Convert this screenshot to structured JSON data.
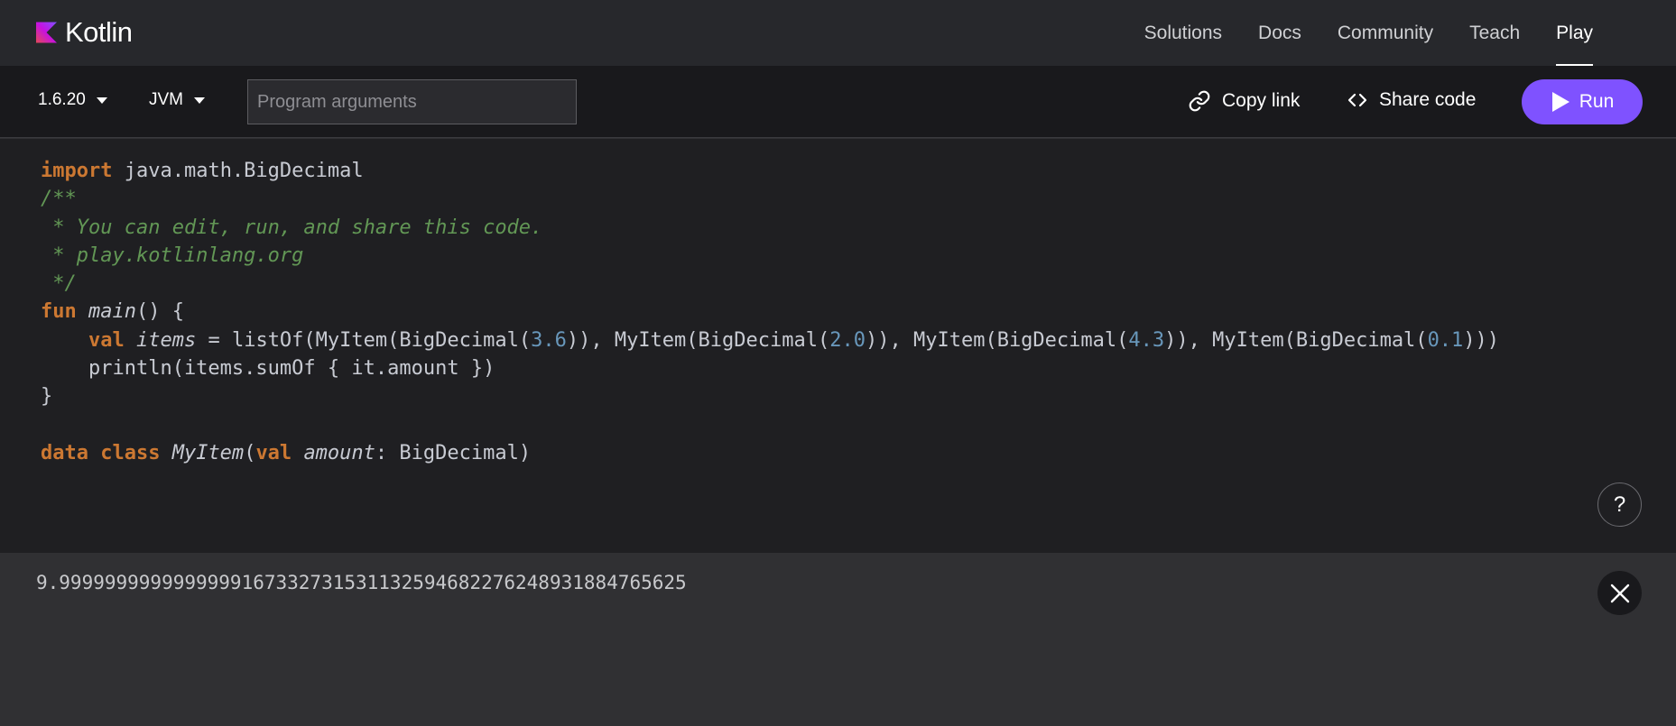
{
  "header": {
    "logo_text": "Kotlin",
    "nav": [
      {
        "label": "Solutions"
      },
      {
        "label": "Docs"
      },
      {
        "label": "Community"
      },
      {
        "label": "Teach"
      },
      {
        "label": "Play",
        "active": true
      }
    ]
  },
  "toolbar": {
    "version": "1.6.20",
    "target": "JVM",
    "args_placeholder": "Program arguments",
    "args_value": "",
    "copy_link_label": "Copy link",
    "share_code_label": "Share code",
    "run_label": "Run"
  },
  "editor": {
    "lines": [
      [
        {
          "t": "import",
          "c": "kw"
        },
        {
          "t": " java.math.BigDecimal"
        }
      ],
      [
        {
          "t": "/**",
          "c": "cm"
        }
      ],
      [
        {
          "t": " * You can edit, run, and share this code.",
          "c": "cm"
        }
      ],
      [
        {
          "t": " * play.kotlinlang.org",
          "c": "cm"
        }
      ],
      [
        {
          "t": " */",
          "c": "cm"
        }
      ],
      [
        {
          "t": "fun",
          "c": "kw"
        },
        {
          "t": " "
        },
        {
          "t": "main",
          "c": "it"
        },
        {
          "t": "() {"
        }
      ],
      [
        {
          "t": "    "
        },
        {
          "t": "val",
          "c": "kw"
        },
        {
          "t": " "
        },
        {
          "t": "items",
          "c": "it"
        },
        {
          "t": " = listOf(MyItem(BigDecimal("
        },
        {
          "t": "3.6",
          "c": "num"
        },
        {
          "t": ")), MyItem(BigDecimal("
        },
        {
          "t": "2.0",
          "c": "num"
        },
        {
          "t": ")), MyItem(BigDecimal("
        },
        {
          "t": "4.3",
          "c": "num"
        },
        {
          "t": ")), MyItem(BigDecimal("
        },
        {
          "t": "0.1",
          "c": "num"
        },
        {
          "t": ")))"
        }
      ],
      [
        {
          "t": "    println(items.sumOf { it.amount })"
        }
      ],
      [
        {
          "t": "}"
        }
      ],
      [
        {
          "t": ""
        }
      ],
      [
        {
          "t": "data class",
          "c": "kw"
        },
        {
          "t": " "
        },
        {
          "t": "MyItem",
          "c": "it"
        },
        {
          "t": "("
        },
        {
          "t": "val",
          "c": "kw"
        },
        {
          "t": " "
        },
        {
          "t": "amount",
          "c": "it"
        },
        {
          "t": ": BigDecimal)"
        }
      ]
    ],
    "help_label": "?"
  },
  "output": {
    "text": "9.99999999999999916733273153113259468227624893188476562 5"
  },
  "colors": {
    "accent": "#7f52ff",
    "keyword": "#cc7832",
    "comment": "#629755",
    "number": "#6897bb"
  }
}
